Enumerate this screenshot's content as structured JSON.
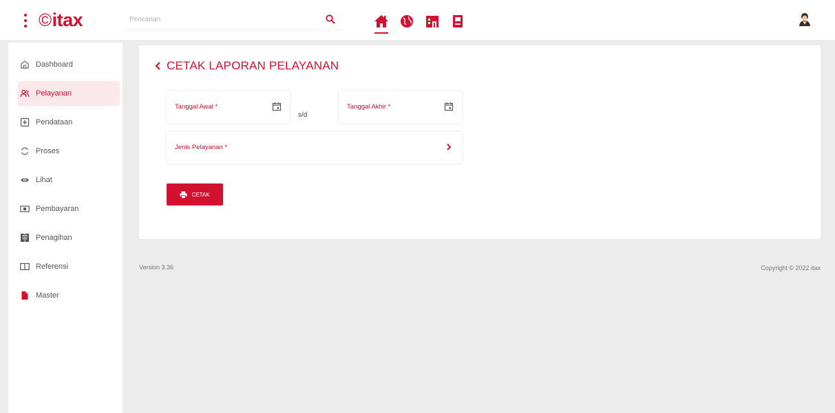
{
  "app": {
    "logo_text": "itax",
    "logo_symbol": "©",
    "accent_color": "#d4102f"
  },
  "search": {
    "placeholder": "Pencarian",
    "icon": "search-icon"
  },
  "top_nav": [
    {
      "icon": "home-icon",
      "active": true
    },
    {
      "icon": "globe-icon",
      "active": false
    },
    {
      "icon": "building-icon",
      "active": false
    },
    {
      "icon": "book-icon",
      "active": false
    }
  ],
  "sidebar": {
    "items": [
      {
        "label": "Dashboard",
        "icon": "home-outline-icon"
      },
      {
        "label": "Pelayanan",
        "icon": "users-icon",
        "active": true
      },
      {
        "label": "Pendataan",
        "icon": "plus-square-icon"
      },
      {
        "label": "Proses",
        "icon": "refresh-icon"
      },
      {
        "label": "Lihat",
        "icon": "eye-icon"
      },
      {
        "label": "Pembayaran",
        "icon": "money-icon"
      },
      {
        "label": "Penagihan",
        "icon": "ledger-icon"
      },
      {
        "label": "Referensi",
        "icon": "open-book-icon"
      },
      {
        "label": "Master",
        "icon": "file-icon"
      }
    ]
  },
  "main": {
    "title": "CETAK LAPORAN PELAYANAN",
    "start_date_label": "Tanggal Awal *",
    "separator": "s/d",
    "end_date_label": "Tanggal Akhir *",
    "service_type_label": "Jenis Pelayanan *",
    "print_button": "CETAK"
  },
  "footer": {
    "version": "Version 3.36",
    "copyright": "Copyright © 2022 itax"
  }
}
